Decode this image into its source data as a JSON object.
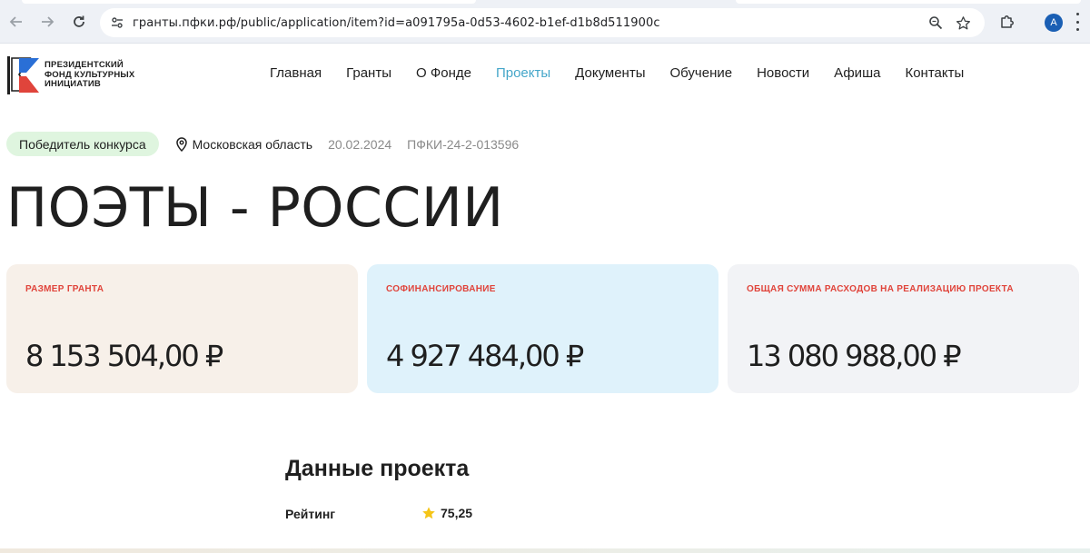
{
  "browser": {
    "url": "гранты.пфки.рф/public/application/item?id=a091795a-0d53-4602-b1ef-d1b8d511900c",
    "profile_initial": "A",
    "icons": {
      "back": "arrow-left-icon",
      "forward": "arrow-right-icon",
      "reload": "reload-icon",
      "site_info": "tune-icon",
      "zoom": "magnifier-icon",
      "bookmark": "star-outline-icon",
      "extensions": "puzzle-icon",
      "menu": "vertical-dots-icon"
    }
  },
  "header": {
    "logo_lines": [
      "ПРЕЗИДЕНТСКИЙ",
      "ФОНД КУЛЬТУРНЫХ",
      "ИНИЦИАТИВ"
    ],
    "nav": [
      {
        "label": "Главная"
      },
      {
        "label": "Гранты"
      },
      {
        "label": "О Фонде"
      },
      {
        "label": "Проекты",
        "active": true
      },
      {
        "label": "Документы"
      },
      {
        "label": "Обучение"
      },
      {
        "label": "Новости"
      },
      {
        "label": "Афиша"
      },
      {
        "label": "Контакты"
      }
    ],
    "active_color": "#45a6c9"
  },
  "meta": {
    "badge": "Победитель конкурса",
    "region": "Московская область",
    "date": "20.02.2024",
    "code": "ПФКИ-24-2-013596"
  },
  "title": "ПОЭТЫ - РОССИИ",
  "cards": [
    {
      "label": "РАЗМЕР ГРАНТА",
      "value": "8 153 504,00 ₽",
      "bg": "#f7f0e9"
    },
    {
      "label": "СОФИНАНСИРОВАНИЕ",
      "value": "4 927 484,00 ₽",
      "bg": "#dff2fb"
    },
    {
      "label": "ОБЩАЯ СУММА РАСХОДОВ НА РЕАЛИЗАЦИЮ ПРОЕКТА",
      "value": "13 080 988,00 ₽",
      "bg": "#f2f3f6"
    }
  ],
  "card_label_color": "#e0443b",
  "project_data": {
    "heading": "Данные проекта",
    "rating_label": "Рейтинг",
    "rating_value": "75,25",
    "star_color": "#f5c518"
  }
}
